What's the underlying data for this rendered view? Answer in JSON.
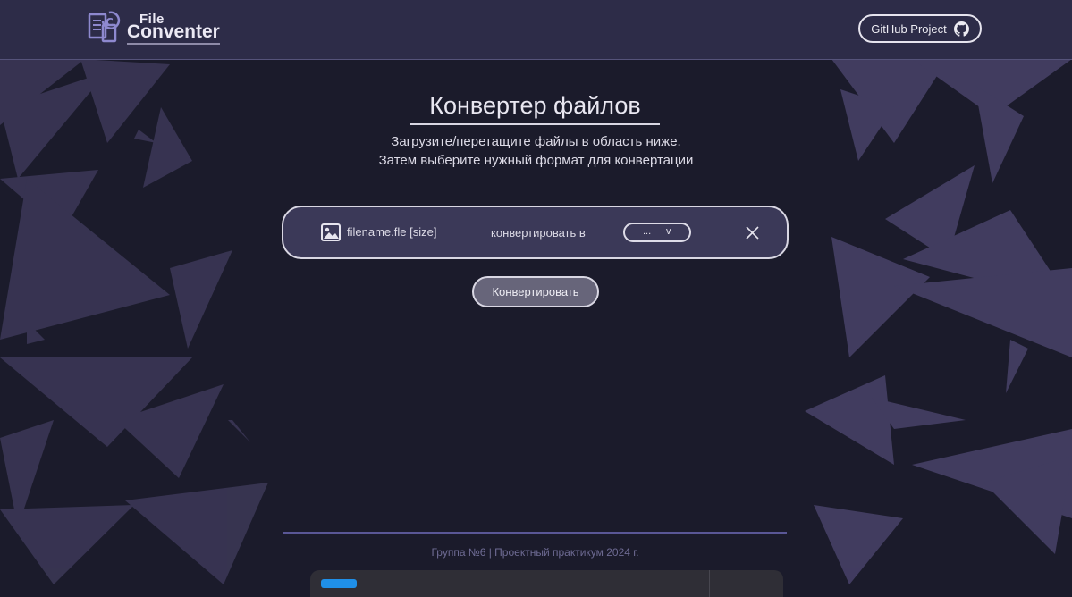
{
  "header": {
    "logo_line1": "File",
    "logo_line2": "Conventer",
    "logo_icon": "file-convert-icon",
    "github_label": "GitHub Project",
    "github_icon": "github-icon"
  },
  "main": {
    "title": "Конвертер файлов",
    "subtitle_line1": "Загрузите/перетащите файлы в область ниже.",
    "subtitle_line2": "Затем выберите нужный формат для конвертации",
    "file_row": {
      "file_icon": "image-icon",
      "filename": "filename.fle [size]",
      "convert_to_label": "конвертировать в",
      "format_value": "...",
      "format_arrow": "v",
      "remove_icon": "close-icon"
    },
    "convert_button": "Конвертировать"
  },
  "footer": {
    "text": "Группа №6 | Проектный практикум 2024 г."
  },
  "colors": {
    "background": "#1b1b2b",
    "header": "#2d2c48",
    "file_row": "#3b3958",
    "triangles": "#4a4466",
    "footer_line": "#5a5796"
  }
}
